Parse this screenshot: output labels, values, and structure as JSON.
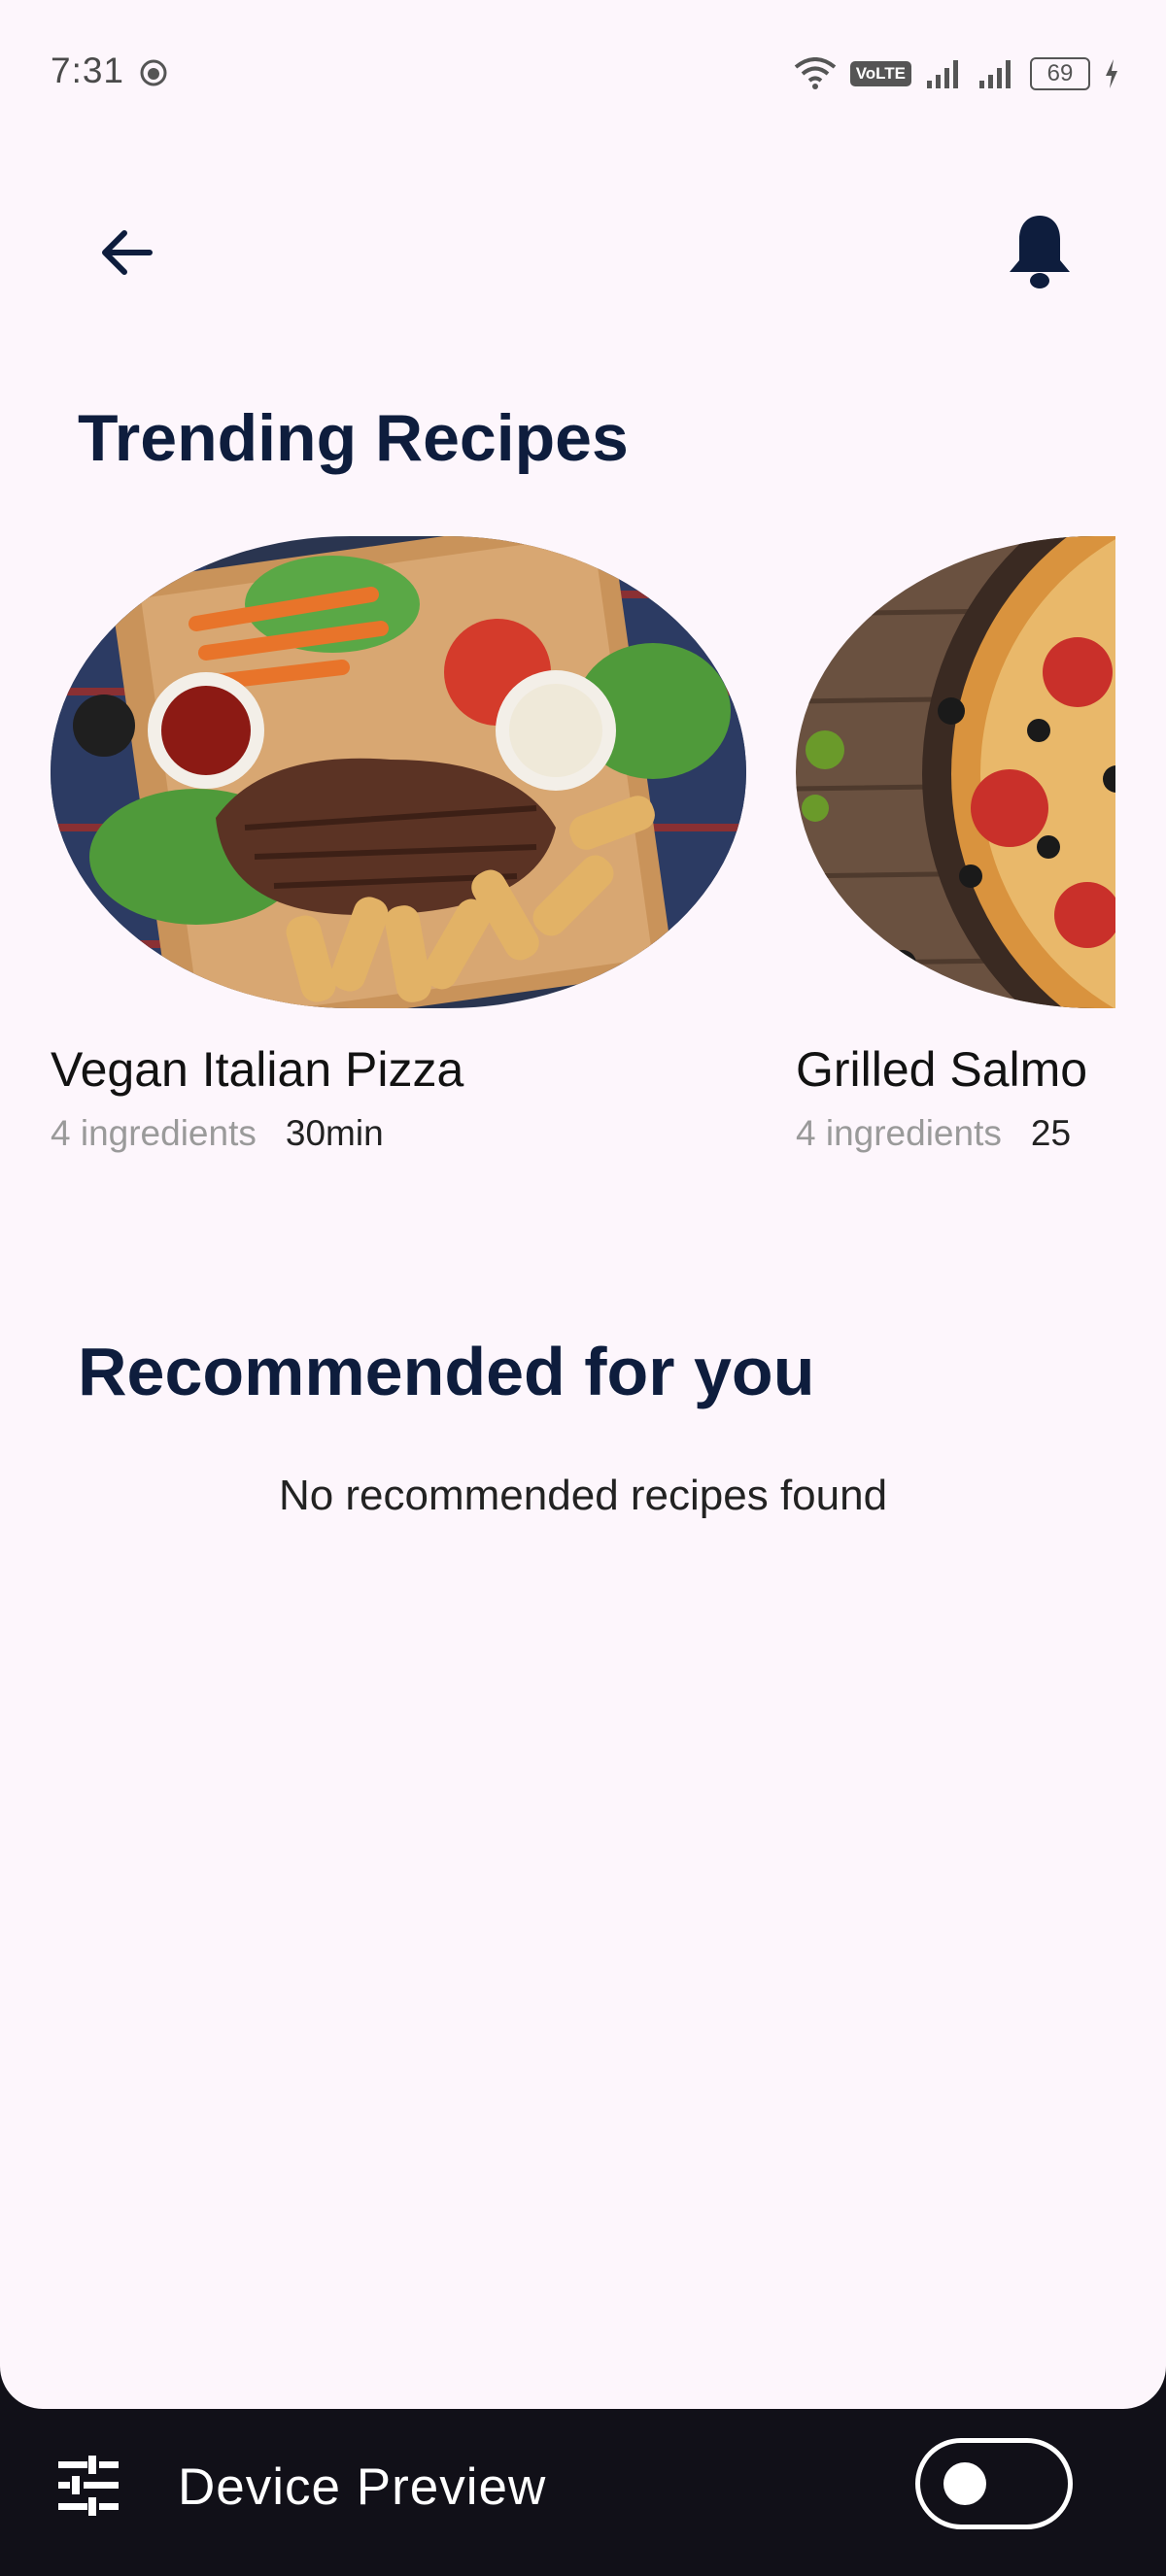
{
  "status_bar": {
    "time": "7:31",
    "network_label": "VoLTE",
    "sim_index": "1",
    "battery": "69",
    "icons": [
      "face-icon",
      "wifi-icon",
      "signal-icon",
      "signal-icon",
      "battery-icon",
      "charging-icon"
    ]
  },
  "app_bar": {
    "back_icon": "arrow-left-icon",
    "notification_icon": "bell-icon"
  },
  "trending": {
    "title": "Trending Recipes",
    "recipes": [
      {
        "title": "Vegan Italian Pizza",
        "ingredients": "4 ingredients",
        "time": "30min"
      },
      {
        "title": "Grilled Salmo",
        "ingredients": "4 ingredients",
        "time": "25"
      }
    ]
  },
  "recommended": {
    "title": "Recommended for you",
    "empty_message": "No recommended recipes found"
  },
  "device_preview": {
    "label": "Device Preview",
    "icon": "tune-icon",
    "toggle_on": false
  },
  "colors": {
    "background": "#fdf6fc",
    "heading": "#0e1d3d",
    "muted_text": "#9a9a9a",
    "preview_bar": "#111018"
  }
}
